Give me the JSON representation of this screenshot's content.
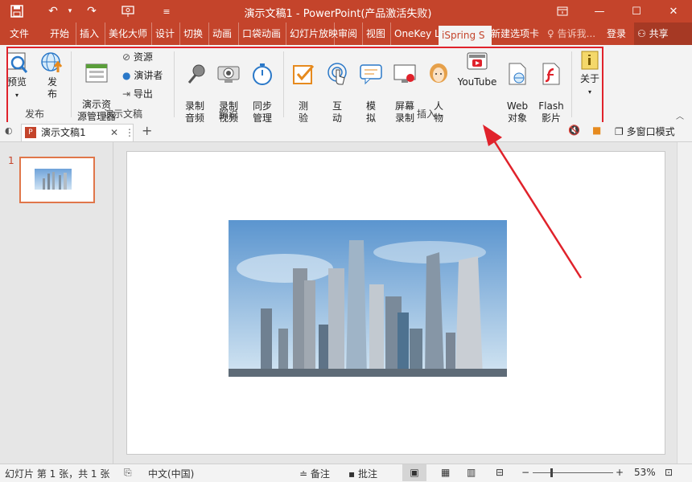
{
  "window": {
    "title": "演示文稿1 - PowerPoint(产品激活失败)",
    "controls": [
      "restore-ribbon",
      "minimize",
      "maximize",
      "close"
    ]
  },
  "tabs": [
    "文件",
    "开始",
    "插入",
    "美化大师",
    "设计",
    "切换",
    "动画",
    "口袋动画",
    "幻灯片放映",
    "审阅",
    "视图",
    "OneKey L",
    "iSpring S",
    "新建选项卡"
  ],
  "active_tab": "iSpring S",
  "tellme": "告诉我...",
  "signin": "登录",
  "share": "共享",
  "ribbon": {
    "publish_group": {
      "label": "发布",
      "preview": "预览",
      "publish": "发布"
    },
    "presentation_group": {
      "label": "演示文稿",
      "manager": "演示资\n源管理器",
      "resources": "资源",
      "presenter": "演讲者",
      "export": "导出"
    },
    "narration_group": {
      "label": "解说",
      "record_audio": "录制\n音频",
      "record_video": "录制\n视频",
      "sync": "同步\n管理"
    },
    "insert_group": {
      "label": "插入",
      "quiz": "测\n验",
      "interaction": "互\n动",
      "simulation": "模\n拟",
      "screen_record": "屏幕\n录制",
      "character": "人\n物",
      "youtube": "YouTube",
      "web": "Web\n对象",
      "flash": "Flash\n影片"
    },
    "about": "关于"
  },
  "doc_tab": {
    "name": "演示文稿1",
    "window_mode": "多窗口模式"
  },
  "slide_panel": {
    "slide_number": "1"
  },
  "status": {
    "slide_info": "幻灯片 第 1 张，共 1 张",
    "language": "中文(中国)",
    "notes": "备注",
    "comments": "批注",
    "zoom": "53%"
  },
  "colors": {
    "accent": "#c4442b",
    "highlight": "#e0222b"
  }
}
